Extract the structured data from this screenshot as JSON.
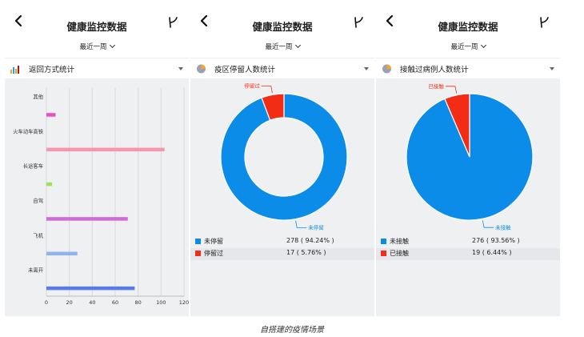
{
  "panels": [
    {
      "title": "健康监控数据",
      "period": "最近一周",
      "selector": {
        "label": "返回方式统计",
        "icon": "bar-chart-icon"
      }
    },
    {
      "title": "健康监控数据",
      "period": "最近一周",
      "selector": {
        "label": "疫区停留人数统计",
        "icon": "pie-chart-icon"
      }
    },
    {
      "title": "健康监控数据",
      "period": "最近一周",
      "selector": {
        "label": "接触过病例人数统计",
        "icon": "pie-chart-icon"
      }
    }
  ],
  "chart_data": [
    {
      "type": "bar",
      "orientation": "horizontal",
      "categories": [
        "其他",
        "火车动车高铁",
        "长途客车",
        "自驾",
        "飞机",
        "未离开"
      ],
      "values": [
        8,
        103,
        5,
        71,
        27,
        77
      ],
      "colors": [
        "#e84fc0",
        "#f597ad",
        "#9fe05a",
        "#d36ad8",
        "#8fb3f1",
        "#5b79e8"
      ],
      "xlim": [
        0,
        120
      ],
      "xticks": [
        "0",
        "20",
        "40",
        "60",
        "80",
        "100",
        "120"
      ],
      "grid": true
    },
    {
      "type": "pie",
      "donut": true,
      "slices": [
        {
          "label": "未停留",
          "value": 278,
          "percent": "94.24%",
          "display": "278 ( 94.24% )",
          "color": "#0b8ce9"
        },
        {
          "label": "停留过",
          "value": 17,
          "percent": "5.76%",
          "display": "17 ( 5.76% )",
          "color": "#f32c15"
        }
      ]
    },
    {
      "type": "pie",
      "donut": false,
      "slices": [
        {
          "label": "未接触",
          "value": 276,
          "percent": "93.56%",
          "display": "276 ( 93.56% )",
          "color": "#0b8ce9"
        },
        {
          "label": "已接触",
          "value": 19,
          "percent": "6.44%",
          "display": "19 ( 6.44% )",
          "color": "#f32c15"
        }
      ]
    }
  ],
  "caption": "自搭建的疫情场景"
}
